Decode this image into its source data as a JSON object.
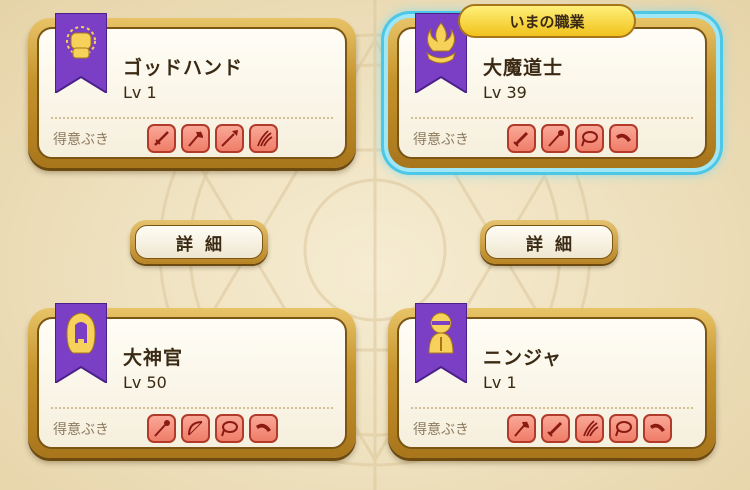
{
  "labels": {
    "weapons_label": "得意ぶき",
    "detail_button": "詳細",
    "current_job_tag": "いまの職業"
  },
  "colors": {
    "card_frame": "#c7952e",
    "banner_purple": "#7a3fc4",
    "weapon_tile": "#ef7d68",
    "current_glow": "#4cc7e6"
  },
  "jobs": [
    {
      "name": "ゴッドハンド",
      "level": "Lv 1",
      "emblem": "god-hand-fist-emblem-icon",
      "current": false,
      "weapons": [
        "sword-icon",
        "axe-icon",
        "spear-icon",
        "claw-icon"
      ]
    },
    {
      "name": "大魔道士",
      "level": "Lv 39",
      "emblem": "flame-hand-emblem-icon",
      "current": true,
      "weapons": [
        "dagger-icon",
        "wand-icon",
        "whip-icon",
        "boomerang-icon"
      ]
    },
    {
      "name": "大神官",
      "level": "Lv 50",
      "emblem": "hooded-priest-emblem-icon",
      "current": false,
      "weapons": [
        "wand-icon",
        "bow-icon",
        "whip-icon",
        "boomerang-icon"
      ]
    },
    {
      "name": "ニンジャ",
      "level": "Lv 1",
      "emblem": "ninja-emblem-icon",
      "current": false,
      "weapons": [
        "axe-icon",
        "dagger-icon",
        "claw-icon",
        "whip-icon",
        "boomerang-icon"
      ]
    }
  ]
}
